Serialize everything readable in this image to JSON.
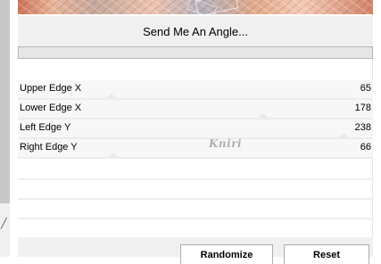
{
  "header": {
    "send_angle_label": "Send Me An Angle...",
    "progress_fraction": 0
  },
  "params": [
    {
      "label": "Upper Edge X",
      "value": "65",
      "fraction": 0.2549
    },
    {
      "label": "Lower Edge X",
      "value": "178",
      "fraction": 0.698
    },
    {
      "label": "Left Edge Y",
      "value": "238",
      "fraction": 0.9333
    },
    {
      "label": "Right Edge Y",
      "value": "66",
      "fraction": 0.2588
    }
  ],
  "watermark": "Kniri",
  "footer": {
    "randomize_label": "Randomize",
    "reset_label": "Reset"
  }
}
